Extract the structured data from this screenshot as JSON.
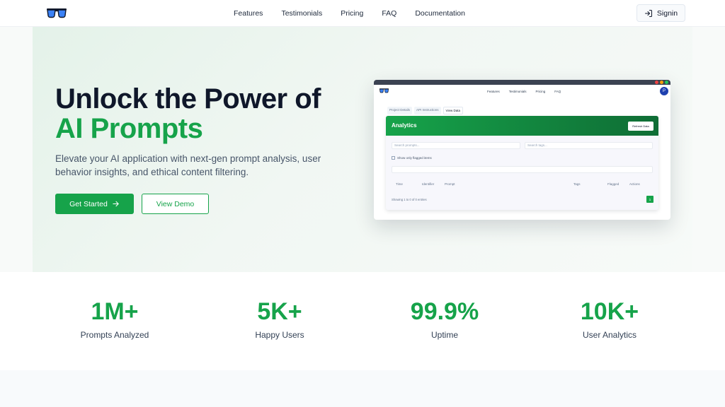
{
  "nav": {
    "links": [
      "Features",
      "Testimonials",
      "Pricing",
      "FAQ",
      "Documentation"
    ],
    "signin_label": "Signin"
  },
  "hero": {
    "title_line1": "Unlock the Power of",
    "title_line2": "AI Prompts",
    "subtitle": "Elevate your AI application with next-gen prompt analysis, user behavior insights, and ethical content filtering.",
    "primary_cta": "Get Started",
    "secondary_cta": "View Demo"
  },
  "mockup": {
    "links": [
      "Features",
      "Testimonials",
      "Pricing",
      "FAQ"
    ],
    "avatar_letter": "P",
    "tabs": [
      "Project Details",
      "API Instructions",
      "View Data"
    ],
    "card_title": "Analytics",
    "refresh_label": "Refresh Data",
    "search_prompts_placeholder": "Search prompts...",
    "search_tags_placeholder": "Search tags...",
    "flagged_label": "Show only flagged items",
    "columns": [
      "Time",
      "Identifier",
      "Prompt",
      "Tags",
      "Flagged",
      "Actions"
    ],
    "footer_text": "Showing 1 to 0 of 0 entries",
    "page_number": "1"
  },
  "stats": [
    {
      "value": "1M+",
      "label": "Prompts Analyzed"
    },
    {
      "value": "5K+",
      "label": "Happy Users"
    },
    {
      "value": "99.9%",
      "label": "Uptime"
    },
    {
      "value": "10K+",
      "label": "User Analytics"
    }
  ],
  "colors": {
    "accent": "#16a34a",
    "dark_text": "#0f172a"
  }
}
